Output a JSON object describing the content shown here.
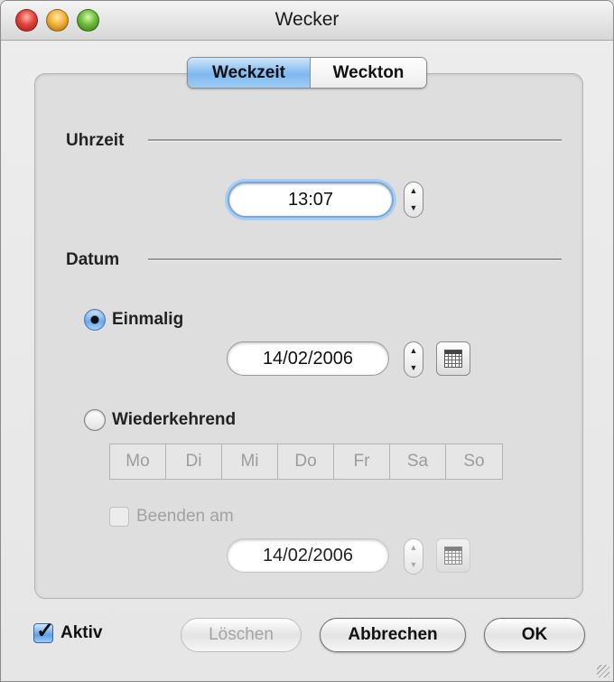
{
  "window": {
    "title": "Wecker"
  },
  "tabs": [
    {
      "label": "Weckzeit",
      "active": true
    },
    {
      "label": "Weckton",
      "active": false
    }
  ],
  "time_section": {
    "label": "Uhrzeit",
    "value": "13:07",
    "stepper_up": "▲",
    "stepper_down": "▼"
  },
  "date_section": {
    "label": "Datum",
    "once": {
      "label": "Einmalig",
      "selected": true,
      "date": "14/02/2006"
    },
    "recurring": {
      "label": "Wiederkehrend",
      "selected": false,
      "days": [
        "Mo",
        "Di",
        "Mi",
        "Do",
        "Fr",
        "Sa",
        "So"
      ],
      "end_checkbox": {
        "label": "Beenden am",
        "checked": false
      },
      "end_date": "14/02/2006"
    }
  },
  "footer": {
    "active_checkbox": {
      "label": "Aktiv",
      "checked": true
    },
    "delete_label": "Löschen",
    "cancel_label": "Abbrechen",
    "ok_label": "OK"
  }
}
